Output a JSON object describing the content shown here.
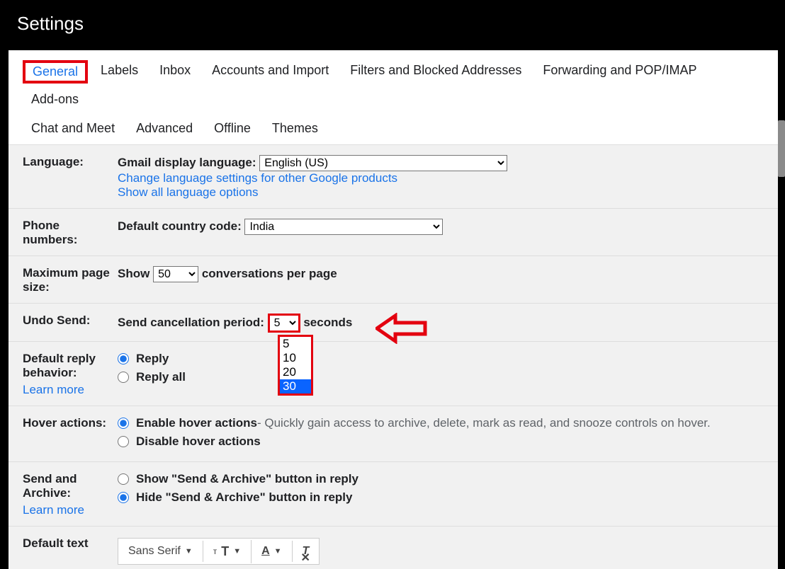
{
  "header": {
    "title": "Settings"
  },
  "tabs": {
    "row1": [
      "General",
      "Labels",
      "Inbox",
      "Accounts and Import",
      "Filters and Blocked Addresses",
      "Forwarding and POP/IMAP",
      "Add-ons"
    ],
    "row2": [
      "Chat and Meet",
      "Advanced",
      "Offline",
      "Themes"
    ],
    "active": "General"
  },
  "language": {
    "label": "Language:",
    "display_label": "Gmail display language:",
    "selected": "English (US)",
    "change_link": "Change language settings for other Google products",
    "show_all_link": "Show all language options"
  },
  "phone": {
    "label": "Phone numbers:",
    "code_label": "Default country code:",
    "selected": "India"
  },
  "pagesize": {
    "label": "Maximum page size:",
    "show": "Show",
    "selected": "50",
    "suffix": "conversations per page"
  },
  "undo": {
    "label": "Undo Send:",
    "period_label": "Send cancellation period:",
    "selected": "5",
    "suffix": "seconds",
    "options": [
      "5",
      "10",
      "20",
      "30"
    ],
    "highlighted": "30"
  },
  "reply": {
    "label": "Default reply behavior:",
    "learn_more": "Learn more",
    "opt1": "Reply",
    "opt2": "Reply all"
  },
  "hover": {
    "label": "Hover actions:",
    "opt1": "Enable hover actions",
    "opt1_desc": " - Quickly gain access to archive, delete, mark as read, and snooze controls on hover.",
    "opt2": "Disable hover actions"
  },
  "sendarchive": {
    "label": "Send and Archive:",
    "learn_more": "Learn more",
    "opt1": "Show \"Send & Archive\" button in reply",
    "opt2": "Hide \"Send & Archive\" button in reply"
  },
  "defaulttext": {
    "label": "Default text",
    "font": "Sans Serif"
  }
}
